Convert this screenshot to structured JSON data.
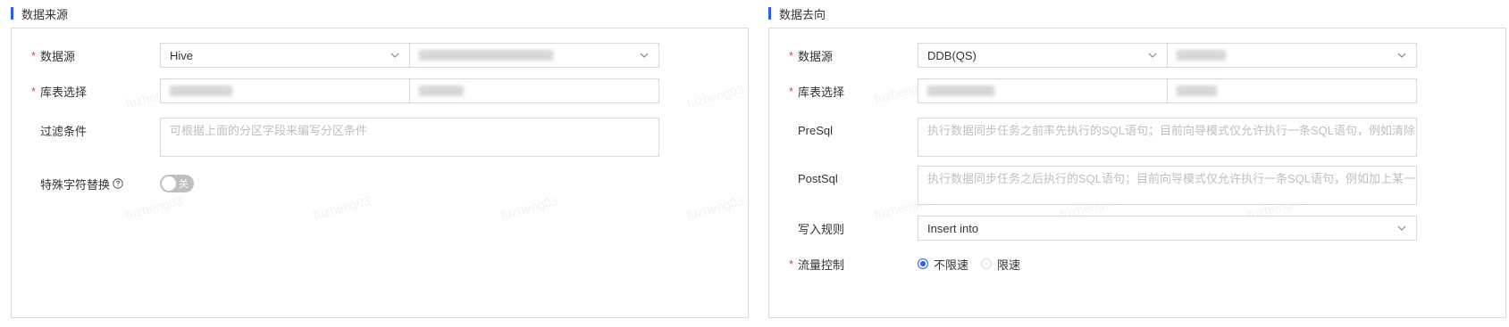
{
  "source": {
    "title": "数据来源",
    "datasource": {
      "label": "数据源",
      "type_value": "Hive"
    },
    "table": {
      "label": "库表选择"
    },
    "filter": {
      "label": "过滤条件",
      "placeholder": "可根据上面的分区字段来编写分区条件"
    },
    "special_char": {
      "label": "特殊字符替换",
      "toggle_label": "关"
    }
  },
  "target": {
    "title": "数据去向",
    "datasource": {
      "label": "数据源",
      "type_value": "DDB(QS)"
    },
    "table": {
      "label": "库表选择"
    },
    "presql": {
      "label": "PreSql",
      "placeholder": "执行数据同步任务之前率先执行的SQL语句；目前向导模式仅允许执行一条SQL语句，例如清除旧数据"
    },
    "postsql": {
      "label": "PostSql",
      "placeholder": "执行数据同步任务之后执行的SQL语句；目前向导模式仅允许执行一条SQL语句，例如加上某一个时间戳"
    },
    "write_rule": {
      "label": "写入规则",
      "value": "Insert into"
    },
    "flow_control": {
      "label": "流量控制",
      "options": [
        "不限速",
        "限速"
      ],
      "selected": "不限速"
    }
  },
  "watermark": "fuzheng03",
  "colors": {
    "accent": "#2d5bff",
    "required": "#f04134",
    "border": "#d9d9d9",
    "placeholder": "#bfbfbf"
  }
}
